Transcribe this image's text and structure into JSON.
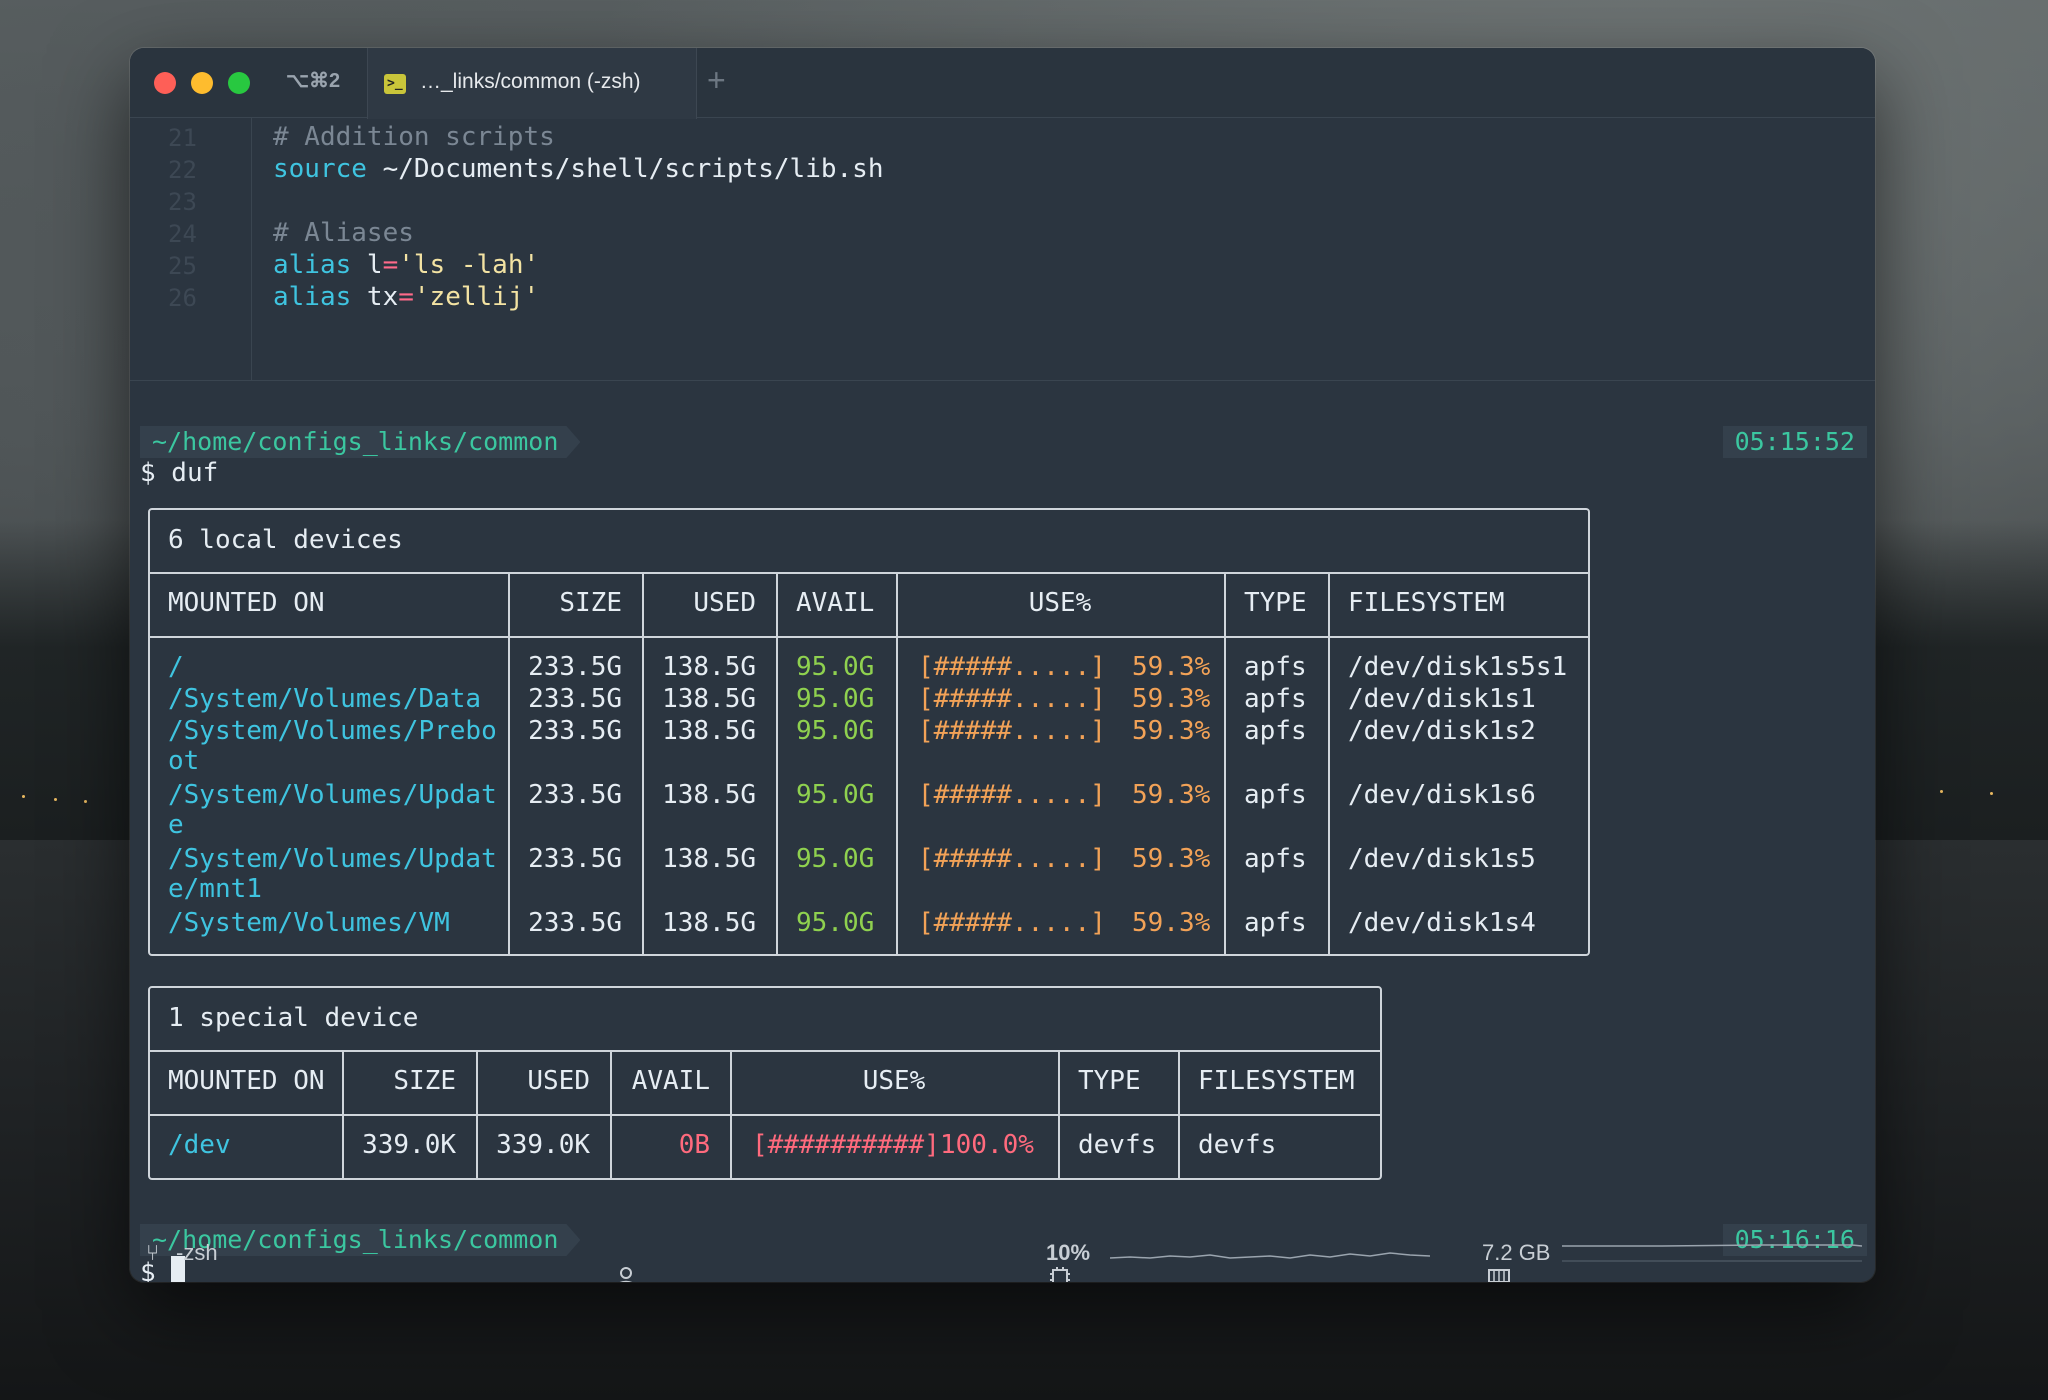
{
  "titlebar": {
    "shortcut": "⌥⌘2",
    "tab_label": "…_links/common (-zsh)",
    "new_tab": "+"
  },
  "editor": {
    "lines": [
      {
        "num": "21",
        "comment": "# Addition scripts"
      },
      {
        "num": "22",
        "kw": "source",
        "rest": " ~/Documents/shell/scripts/lib.sh"
      },
      {
        "num": "23"
      },
      {
        "num": "24",
        "comment": "# Aliases"
      },
      {
        "num": "25",
        "kw": "alias",
        "name": " l",
        "eq": "=",
        "str": "'ls -lah'"
      },
      {
        "num": "26",
        "kw": "alias",
        "name": " tx",
        "eq": "=",
        "str": "'zellij'"
      }
    ]
  },
  "session1": {
    "path": "~/home/configs_links/common",
    "time": "05:15:52",
    "command": "$ duf"
  },
  "local_table": {
    "title": "6 local devices",
    "headers": [
      "MOUNTED ON",
      "SIZE",
      "USED",
      "AVAIL",
      "USE%",
      "TYPE",
      "FILESYSTEM"
    ],
    "rows": [
      {
        "mount": "/",
        "size": "233.5G",
        "used": "138.5G",
        "avail": "95.0G",
        "bar": "[#####.....]",
        "pct": "59.3%",
        "type": "apfs",
        "fs": "/dev/disk1s5s1"
      },
      {
        "mount": "/System/Volumes/Data",
        "size": "233.5G",
        "used": "138.5G",
        "avail": "95.0G",
        "bar": "[#####.....]",
        "pct": "59.3%",
        "type": "apfs",
        "fs": "/dev/disk1s1"
      },
      {
        "mount": "/System/Volumes/Prebo\not",
        "size": "233.5G",
        "used": "138.5G",
        "avail": "95.0G",
        "bar": "[#####.....]",
        "pct": "59.3%",
        "type": "apfs",
        "fs": "/dev/disk1s2"
      },
      {
        "mount": "/System/Volumes/Updat\ne",
        "size": "233.5G",
        "used": "138.5G",
        "avail": "95.0G",
        "bar": "[#####.....]",
        "pct": "59.3%",
        "type": "apfs",
        "fs": "/dev/disk1s6"
      },
      {
        "mount": "/System/Volumes/Updat\ne/mnt1",
        "size": "233.5G",
        "used": "138.5G",
        "avail": "95.0G",
        "bar": "[#####.....]",
        "pct": "59.3%",
        "type": "apfs",
        "fs": "/dev/disk1s5"
      },
      {
        "mount": "/System/Volumes/VM",
        "size": "233.5G",
        "used": "138.5G",
        "avail": "95.0G",
        "bar": "[#####.....]",
        "pct": "59.3%",
        "type": "apfs",
        "fs": "/dev/disk1s4"
      }
    ]
  },
  "special_table": {
    "title": "1 special device",
    "headers": [
      "MOUNTED ON",
      "SIZE",
      "USED",
      "AVAIL",
      "USE%",
      "TYPE",
      "FILESYSTEM"
    ],
    "rows": [
      {
        "mount": "/dev",
        "size": "339.0K",
        "used": "339.0K",
        "avail": "0B",
        "bar": "[##########]",
        "pct": "100.0%",
        "type": "devfs",
        "fs": "devfs"
      }
    ]
  },
  "session2": {
    "path": "~/home/configs_links/common",
    "time": "05:16:16",
    "prompt": "$ "
  },
  "statusbar": {
    "shell": "-zsh",
    "cpu": "10%",
    "memory": "7.2 GB"
  },
  "colors": {
    "prompt_path": "#3bc7a0",
    "mount": "#3fc4e0",
    "avail": "#8fd14f",
    "usage": "#f2a257",
    "full": "#ff6a7d"
  }
}
